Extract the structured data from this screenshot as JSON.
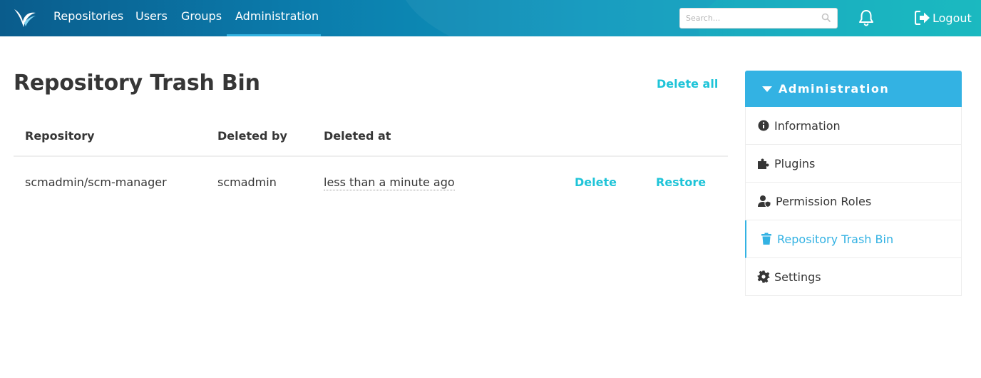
{
  "navbar": {
    "items": [
      {
        "label": "Repositories",
        "active": false
      },
      {
        "label": "Users",
        "active": false
      },
      {
        "label": "Groups",
        "active": false
      },
      {
        "label": "Administration",
        "active": true
      }
    ],
    "search_placeholder": "Search...",
    "logout_label": "Logout",
    "icons": [
      "logo-icon",
      "search-icon",
      "bell-icon",
      "logout-icon"
    ]
  },
  "main": {
    "title": "Repository Trash Bin",
    "delete_all_label": "Delete all",
    "table": {
      "headers": [
        "Repository",
        "Deleted by",
        "Deleted at"
      ],
      "rows": [
        {
          "repository": "scmadmin/scm-manager",
          "deleted_by": "scmadmin",
          "deleted_at": "less than a minute ago",
          "delete_label": "Delete",
          "restore_label": "Restore"
        }
      ]
    }
  },
  "sidebar": {
    "title": "Administration",
    "items": [
      {
        "label": "Information",
        "icon": "info-circle-icon"
      },
      {
        "label": "Plugins",
        "icon": "puzzle-icon"
      },
      {
        "label": "Permission Roles",
        "icon": "user-shield-icon"
      },
      {
        "label": "Repository Trash Bin",
        "icon": "trash-icon",
        "active": true
      },
      {
        "label": "Settings",
        "icon": "gear-icon"
      }
    ]
  },
  "colors": {
    "accent": "#33b2e3",
    "link": "#1fc4d8",
    "text": "#363636"
  }
}
